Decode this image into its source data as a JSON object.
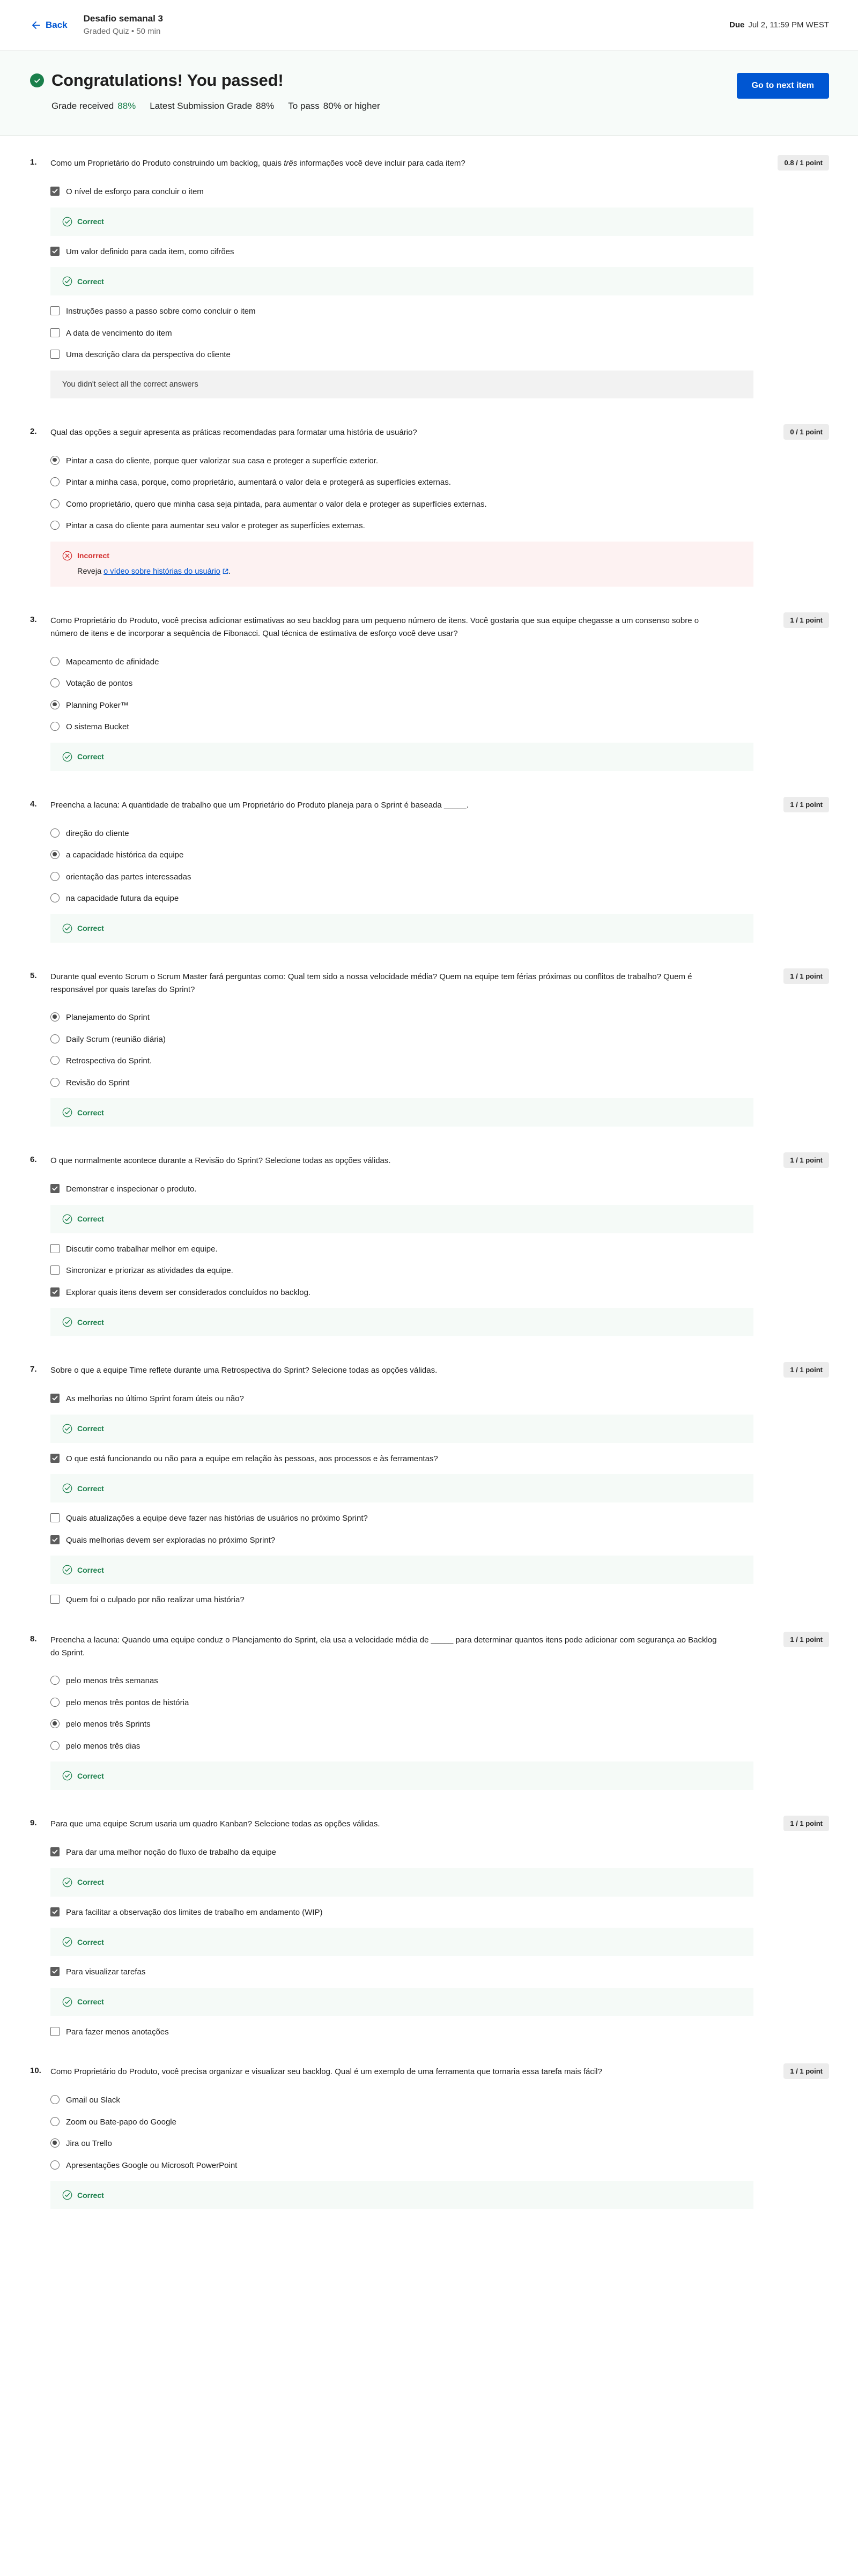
{
  "header": {
    "back_label": "Back",
    "back_icon": "arrow-left-icon",
    "quiz_title": "Desafio semanal 3",
    "quiz_subtitle": "Graded Quiz • 50 min",
    "due_label": "Due",
    "due_value": "Jul 2, 11:59 PM WEST"
  },
  "banner": {
    "pass_icon": "check-circle-icon",
    "congrats": "Congratulations! You passed!",
    "grade_received_label": "Grade received",
    "grade_received_value": "88%",
    "latest_submission_label": "Latest Submission Grade",
    "latest_submission_value": "88%",
    "to_pass_label": "To pass",
    "to_pass_value": "80% or higher",
    "next_button": "Go to next item",
    "accent_blue": "#0056D2",
    "accent_green": "#1A7F4B",
    "accent_red": "#D32F2F"
  },
  "feedback_labels": {
    "correct": "Correct",
    "incorrect": "Incorrect"
  },
  "questions": [
    {
      "number": "1.",
      "text": "Como um Proprietário do Produto construindo um backlog, quais três informações você deve incluir para cada item?",
      "italic_word": "três",
      "points": "0.8 / 1 point",
      "type": "checkbox",
      "options": [
        {
          "label": "O nível de esforço para concluir o item",
          "state": "checked",
          "feedback": "correct"
        },
        {
          "label": "Um valor definido para cada item, como cifrões",
          "state": "checked",
          "feedback": "correct"
        },
        {
          "label": "Instruções passo a passo sobre como concluir o item",
          "state": "unchecked",
          "feedback": null
        },
        {
          "label": "A data de vencimento do item",
          "state": "unchecked",
          "feedback": null
        },
        {
          "label": "Uma descrição clara da perspectiva do cliente",
          "state": "unchecked",
          "feedback": null
        }
      ],
      "footer_note": "You didn't select all the correct answers"
    },
    {
      "number": "2.",
      "text": "Qual das opções a seguir apresenta as práticas recomendadas para formatar uma história de usuário?",
      "points": "0 / 1 point",
      "type": "radio",
      "options": [
        {
          "label": "Pintar a casa do cliente, porque quer valorizar sua casa e proteger a superfície exterior.",
          "state": "selected",
          "feedback": null
        },
        {
          "label": "Pintar a minha casa, porque, como proprietário, aumentará o valor dela e protegerá as superfícies externas.",
          "state": "unselected",
          "feedback": null
        },
        {
          "label": "Como proprietário, quero que minha casa seja pintada, para aumentar o valor dela e proteger as superfícies externas.",
          "state": "unselected",
          "feedback": null
        },
        {
          "label": "Pintar a casa do cliente para aumentar seu valor e proteger as superfícies externas.",
          "state": "unselected",
          "feedback": null
        }
      ],
      "incorrect_feedback": {
        "prefix": "Reveja ",
        "link_text": "o vídeo sobre histórias do usuário",
        "suffix": "."
      }
    },
    {
      "number": "3.",
      "text": "Como Proprietário do Produto, você precisa adicionar estimativas ao seu backlog para um pequeno número de itens. Você gostaria que sua equipe chegasse a um consenso sobre o número de itens e de incorporar a sequência de Fibonacci. Qual técnica de estimativa de esforço você deve usar?",
      "points": "1 / 1 point",
      "type": "radio",
      "options": [
        {
          "label": "Mapeamento de afinidade",
          "state": "unselected",
          "feedback": null
        },
        {
          "label": "Votação de pontos",
          "state": "unselected",
          "feedback": null
        },
        {
          "label": "Planning Poker™",
          "state": "selected",
          "feedback": null
        },
        {
          "label": "O sistema Bucket",
          "state": "unselected",
          "feedback": null
        }
      ],
      "trailing_feedback": "correct"
    },
    {
      "number": "4.",
      "text": "Preencha a lacuna: A quantidade de trabalho que um Proprietário do Produto planeja para o Sprint é baseada _____.",
      "points": "1 / 1 point",
      "type": "radio",
      "options": [
        {
          "label": "direção do cliente",
          "state": "unselected",
          "feedback": null
        },
        {
          "label": "a capacidade histórica da equipe",
          "state": "selected",
          "feedback": null
        },
        {
          "label": "orientação das partes interessadas",
          "state": "unselected",
          "feedback": null
        },
        {
          "label": "na capacidade futura da equipe",
          "state": "unselected",
          "feedback": null
        }
      ],
      "trailing_feedback": "correct"
    },
    {
      "number": "5.",
      "text": "Durante qual evento Scrum o Scrum Master fará perguntas como: Qual tem sido a nossa velocidade média? Quem na equipe tem férias próximas ou conflitos de trabalho? Quem é responsável por quais tarefas do Sprint?",
      "points": "1 / 1 point",
      "type": "radio",
      "options": [
        {
          "label": "Planejamento do Sprint",
          "state": "selected",
          "feedback": null
        },
        {
          "label": "Daily Scrum (reunião diária)",
          "state": "unselected",
          "feedback": null
        },
        {
          "label": "Retrospectiva do Sprint.",
          "state": "unselected",
          "feedback": null
        },
        {
          "label": "Revisão do Sprint",
          "state": "unselected",
          "feedback": null
        }
      ],
      "trailing_feedback": "correct"
    },
    {
      "number": "6.",
      "text": "O que normalmente acontece durante a Revisão do Sprint? Selecione todas as opções válidas.",
      "points": "1 / 1 point",
      "type": "checkbox",
      "options": [
        {
          "label": "Demonstrar e inspecionar o produto.",
          "state": "checked",
          "feedback": "correct"
        },
        {
          "label": "Discutir como trabalhar melhor em equipe.",
          "state": "unchecked",
          "feedback": null
        },
        {
          "label": "Sincronizar e priorizar as atividades da equipe.",
          "state": "unchecked",
          "feedback": null
        },
        {
          "label": "Explorar quais itens devem ser considerados concluídos no backlog.",
          "state": "checked",
          "feedback": "correct"
        }
      ]
    },
    {
      "number": "7.",
      "text": "Sobre o que a equipe Time reflete durante uma Retrospectiva do Sprint? Selecione todas as opções válidas.",
      "points": "1 / 1 point",
      "type": "checkbox",
      "options": [
        {
          "label": "As melhorias no último Sprint foram úteis ou não?",
          "state": "checked",
          "feedback": "correct"
        },
        {
          "label": "O que está funcionando ou não para a equipe em relação às pessoas, aos processos e às ferramentas?",
          "state": "checked",
          "feedback": "correct"
        },
        {
          "label": "Quais atualizações a equipe deve fazer nas histórias de usuários no próximo Sprint?",
          "state": "unchecked",
          "feedback": null
        },
        {
          "label": "Quais melhorias devem ser exploradas no próximo Sprint?",
          "state": "checked",
          "feedback": "correct"
        },
        {
          "label": "Quem foi o culpado por não realizar uma história?",
          "state": "unchecked",
          "feedback": null
        }
      ]
    },
    {
      "number": "8.",
      "text": "Preencha a lacuna: Quando uma equipe conduz o Planejamento do Sprint, ela usa a velocidade média de _____ para determinar quantos itens pode adicionar com segurança ao Backlog do Sprint.",
      "points": "1 / 1 point",
      "type": "radio",
      "options": [
        {
          "label": "pelo menos três semanas",
          "state": "unselected",
          "feedback": null
        },
        {
          "label": "pelo menos três pontos de história",
          "state": "unselected",
          "feedback": null
        },
        {
          "label": "pelo menos três Sprints",
          "state": "selected",
          "feedback": null
        },
        {
          "label": "pelo menos três dias",
          "state": "unselected",
          "feedback": null
        }
      ],
      "trailing_feedback": "correct"
    },
    {
      "number": "9.",
      "text": "Para que uma equipe Scrum usaria um quadro Kanban? Selecione todas as opções válidas.",
      "points": "1 / 1 point",
      "type": "checkbox",
      "options": [
        {
          "label": "Para dar uma melhor noção do fluxo de trabalho da equipe",
          "state": "checked",
          "feedback": "correct"
        },
        {
          "label": "Para facilitar a observação dos limites de trabalho em andamento (WIP)",
          "state": "checked",
          "feedback": "correct"
        },
        {
          "label": "Para visualizar tarefas",
          "state": "checked",
          "feedback": "correct"
        },
        {
          "label": "Para fazer menos anotações",
          "state": "unchecked",
          "feedback": null
        }
      ]
    },
    {
      "number": "10.",
      "text": "Como Proprietário do Produto, você precisa organizar e visualizar seu backlog. Qual é um exemplo de uma ferramenta que tornaria essa tarefa mais fácil?",
      "points": "1 / 1 point",
      "type": "radio",
      "options": [
        {
          "label": "Gmail ou Slack",
          "state": "unselected",
          "feedback": null
        },
        {
          "label": "Zoom ou Bate-papo do Google",
          "state": "unselected",
          "feedback": null
        },
        {
          "label": "Jira ou Trello",
          "state": "selected",
          "feedback": null
        },
        {
          "label": "Apresentações Google ou Microsoft PowerPoint",
          "state": "unselected",
          "feedback": null
        }
      ],
      "trailing_feedback": "correct"
    }
  ]
}
